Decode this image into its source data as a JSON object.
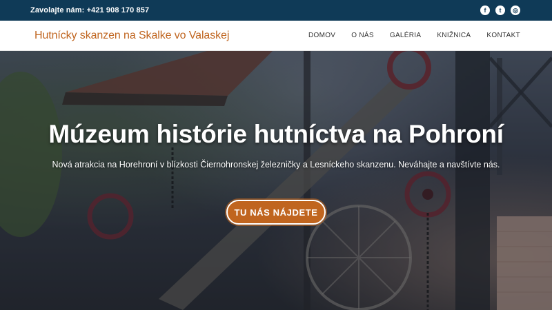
{
  "topbar": {
    "phone": "Zavolajte nám: +421 908 170 857",
    "social": [
      {
        "icon": "facebook-icon",
        "glyph": "f"
      },
      {
        "icon": "twitter-icon",
        "glyph": "t"
      },
      {
        "icon": "instagram-icon",
        "glyph": "◎"
      }
    ]
  },
  "header": {
    "brand": "Hutnícky skanzen na Skalke vo Valaskej",
    "menu": [
      "DOMOV",
      "O NÁS",
      "GALÉRIA",
      "KNIŽNICA",
      "KONTAKT"
    ]
  },
  "hero": {
    "title": "Múzeum histórie hutníctva na Pohroní",
    "subtitle": "Nová atrakcia na Horehroní v blízkosti Čiernohronskej železničky a Lesníckeho skanzenu. Neváhajte a navštívte nás.",
    "cta": "TU NÁS NÁJDETE"
  },
  "colors": {
    "topbar_bg": "#0f3a57",
    "brand_orange": "#c0651f",
    "nav_text": "#333333"
  }
}
